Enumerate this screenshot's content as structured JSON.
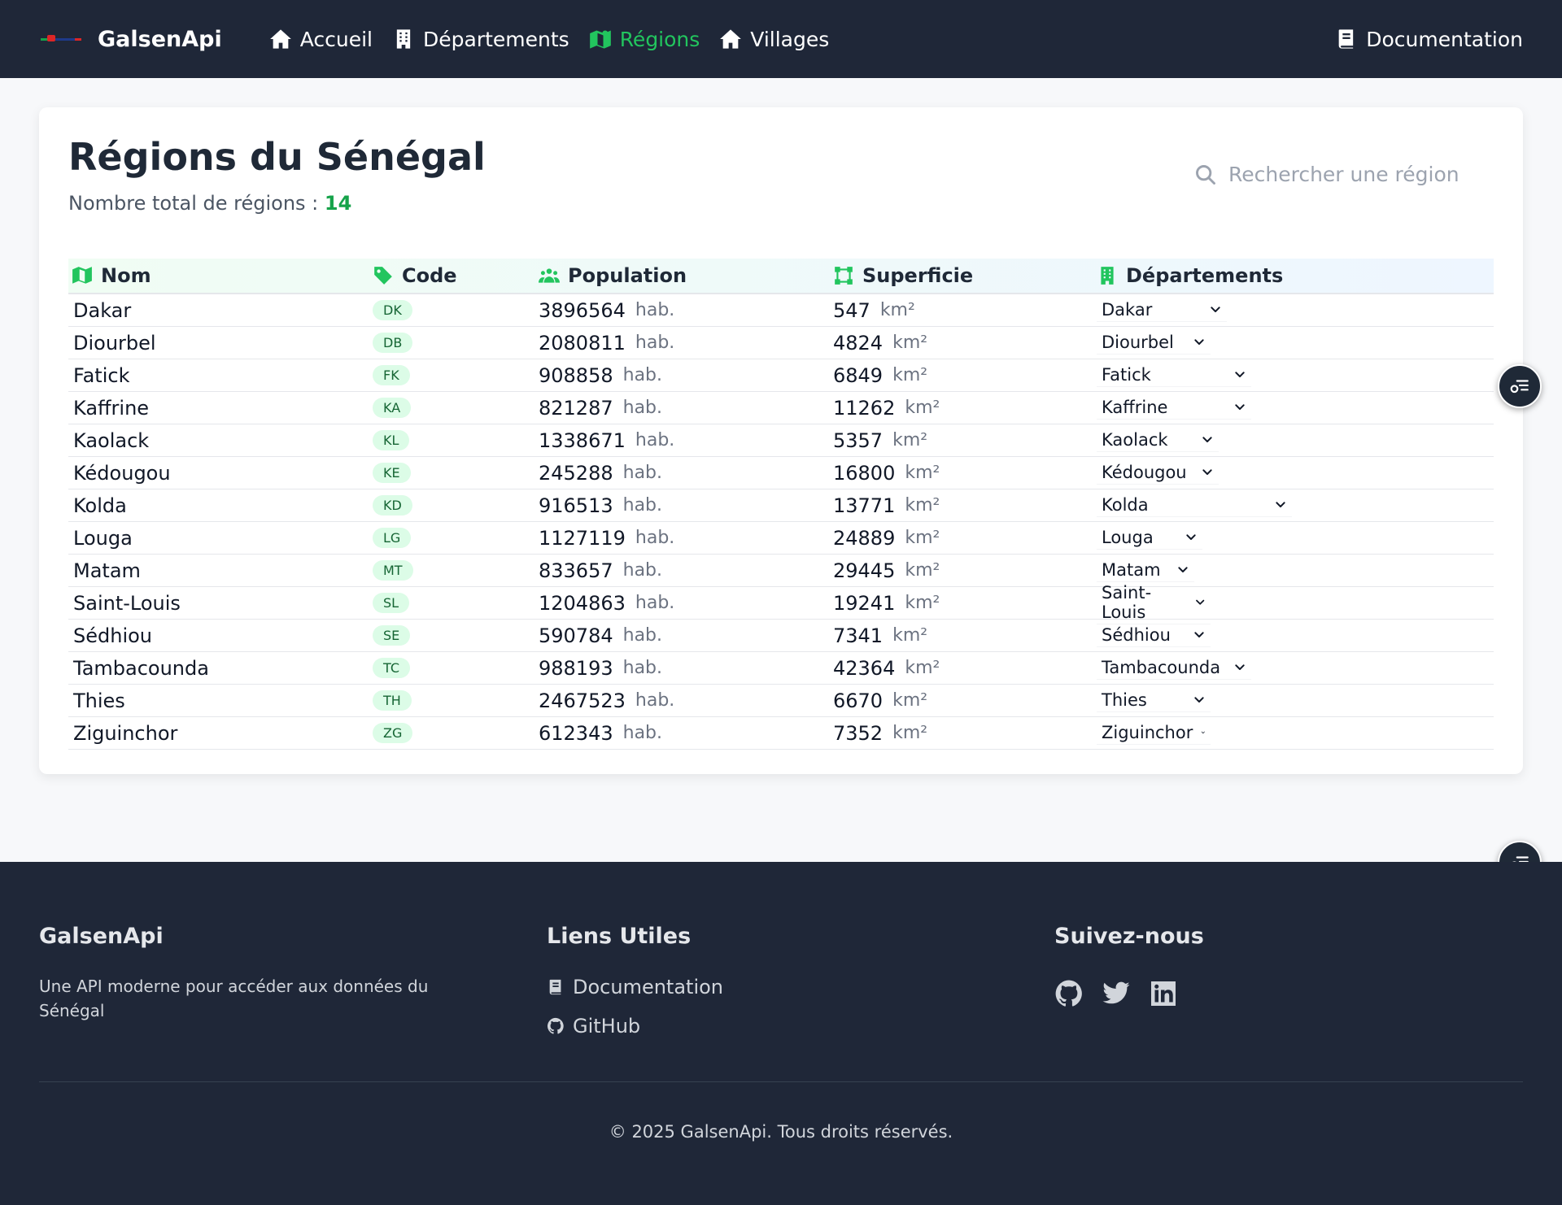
{
  "nav": {
    "brand": "GalsenApi",
    "links": [
      {
        "label": "Accueil",
        "icon": "home-icon",
        "active": false
      },
      {
        "label": "Départements",
        "icon": "building-icon",
        "active": false
      },
      {
        "label": "Régions",
        "icon": "map-icon",
        "active": true
      },
      {
        "label": "Villages",
        "icon": "home-icon",
        "active": false
      }
    ],
    "documentation": "Documentation"
  },
  "main": {
    "title": "Régions du Sénégal",
    "count_label": "Nombre total de régions :",
    "count_value": "14",
    "search_placeholder": "Rechercher une région"
  },
  "table": {
    "headers": {
      "name": "Nom",
      "code": "Code",
      "population": "Population",
      "area": "Superficie",
      "departments": "Départements"
    },
    "population_unit": "hab.",
    "area_unit": "km²",
    "rows": [
      {
        "name": "Dakar",
        "code": "DK",
        "population": "3896564",
        "area": "547",
        "department": "Dakar"
      },
      {
        "name": "Diourbel",
        "code": "DB",
        "population": "2080811",
        "area": "4824",
        "department": "Diourbel"
      },
      {
        "name": "Fatick",
        "code": "FK",
        "population": "908858",
        "area": "6849",
        "department": "Fatick"
      },
      {
        "name": "Kaffrine",
        "code": "KA",
        "population": "821287",
        "area": "11262",
        "department": "Kaffrine"
      },
      {
        "name": "Kaolack",
        "code": "KL",
        "population": "1338671",
        "area": "5357",
        "department": "Kaolack"
      },
      {
        "name": "Kédougou",
        "code": "KE",
        "population": "245288",
        "area": "16800",
        "department": "Kédougou"
      },
      {
        "name": "Kolda",
        "code": "KD",
        "population": "916513",
        "area": "13771",
        "department": "Kolda"
      },
      {
        "name": "Louga",
        "code": "LG",
        "population": "1127119",
        "area": "24889",
        "department": "Louga"
      },
      {
        "name": "Matam",
        "code": "MT",
        "population": "833657",
        "area": "29445",
        "department": "Matam"
      },
      {
        "name": "Saint-Louis",
        "code": "SL",
        "population": "1204863",
        "area": "19241",
        "department": "Saint-Louis"
      },
      {
        "name": "Sédhiou",
        "code": "SE",
        "population": "590784",
        "area": "7341",
        "department": "Sédhiou"
      },
      {
        "name": "Tambacounda",
        "code": "TC",
        "population": "988193",
        "area": "42364",
        "department": "Tambacounda"
      },
      {
        "name": "Thies",
        "code": "TH",
        "population": "2467523",
        "area": "6670",
        "department": "Thies"
      },
      {
        "name": "Ziguinchor",
        "code": "ZG",
        "population": "612343",
        "area": "7352",
        "department": "Ziguinchor"
      }
    ]
  },
  "footer": {
    "brand": "GalsenApi",
    "description": "Une API moderne pour accéder aux données du Sénégal",
    "links_title": "Liens Utiles",
    "links": [
      "Documentation",
      "GitHub"
    ],
    "social_title": "Suivez-nous",
    "socials": [
      "github-icon",
      "twitter-icon",
      "linkedin-icon"
    ],
    "copyright": "© 2025 GalsenApi. Tous droits réservés."
  },
  "colors": {
    "nav_bg": "#1f2738",
    "accent": "#22c55e",
    "badge_bg": "#dcfce7",
    "badge_text": "#166534"
  }
}
